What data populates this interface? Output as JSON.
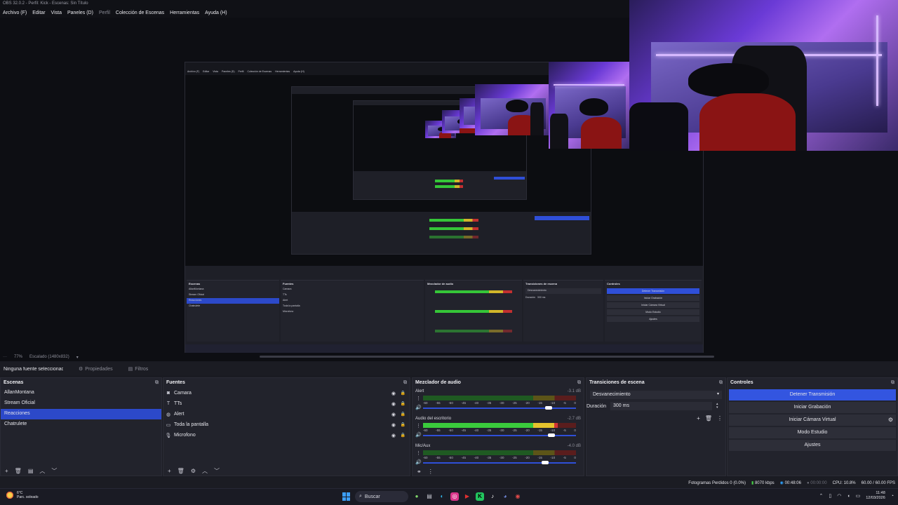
{
  "window": {
    "title": "OBS 32.0.2 - Perfil: Kick - Escenas: Sin Título"
  },
  "menu": [
    "Archivo (F)",
    "Editar",
    "Vista",
    "Paneles (D)",
    "Perfil",
    "Colección de Escenas",
    "Herramientas",
    "Ayuda (H)"
  ],
  "scale": {
    "zoom": "77%",
    "mode": "Escalado (1480x832)"
  },
  "source_toolbar": {
    "none_selected": "Ninguna fuente seleccionada",
    "properties": "Propiedades",
    "filters": "Filtros"
  },
  "scenes": {
    "title": "Escenas",
    "items": [
      "AllanMontana",
      "Stream Oficial",
      "Reacciones",
      "Chatrulete"
    ],
    "selected_index": 2
  },
  "sources": {
    "title": "Fuentes",
    "items": [
      {
        "icon": "camera-icon",
        "label": "Camara"
      },
      {
        "icon": "text-icon",
        "label": "TTs"
      },
      {
        "icon": "browser-icon",
        "label": "Alert"
      },
      {
        "icon": "monitor-icon",
        "label": "Toda la pantalla"
      },
      {
        "icon": "microphone-icon",
        "label": "Microfono"
      }
    ]
  },
  "mixer": {
    "title": "Mezclador de audio",
    "ticks": [
      "-60",
      "-55",
      "-50",
      "-45",
      "-40",
      "-35",
      "-30",
      "-25",
      "-20",
      "-15",
      "-10",
      "-5",
      "0"
    ],
    "channels": [
      {
        "name": "Alert",
        "db": "-3.1 dB",
        "level": 0.0,
        "volume": 0.82
      },
      {
        "name": "Audio del escritorio",
        "db": "-2.7 dB",
        "level": 0.88,
        "volume": 0.84
      },
      {
        "name": "Mic/Aux",
        "db": "-4.0 dB",
        "level": 0.0,
        "volume": 0.8
      }
    ]
  },
  "transitions": {
    "title": "Transiciones de escena",
    "selected": "Desvanecimiento",
    "duration_label": "Duración",
    "duration_value": "300 ms"
  },
  "controls": {
    "title": "Controles",
    "stop_stream": "Detener Transmisión",
    "start_recording": "Iniciar Grabación",
    "virtual_cam": "Iniciar Cámara Virtual",
    "studio_mode": "Modo Estudio",
    "settings": "Ajustes"
  },
  "status": {
    "dropped_frames": "Fotogramas Perdidos 0 (0.0%)",
    "bitrate": "8070 kbps",
    "stream_time": "00:48:06",
    "rec_time": "00:00:00",
    "cpu": "CPU: 10.8%",
    "fps": "60.00 / 60.00 FPS"
  },
  "taskbar": {
    "weather_temp": "6°C",
    "weather_desc": "Parc. soleado",
    "search_placeholder": "Buscar",
    "time": "11:48",
    "date": "12/03/2026"
  },
  "colors": {
    "accent": "#2c49c9",
    "button_active": "#3355e0",
    "meter_green": "#3acb3c",
    "meter_yellow": "#e5c22d",
    "meter_red": "#d23434"
  }
}
